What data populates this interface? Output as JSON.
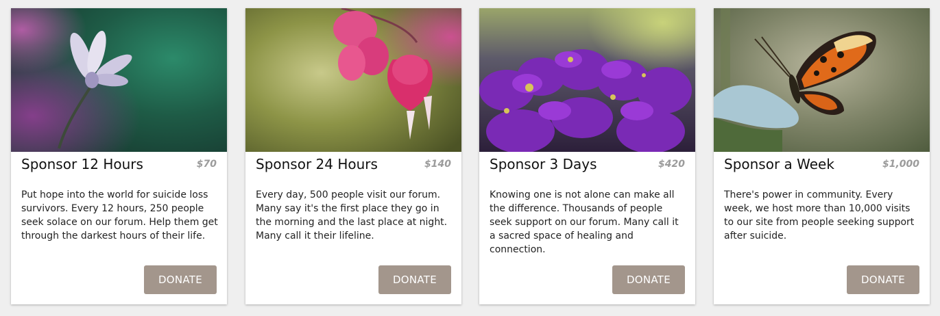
{
  "cards": [
    {
      "title": "Sponsor 12 Hours",
      "price": "$70",
      "description": "Put hope into the world for suicide loss survivors. Every 12 hours, 250 people seek solace on our forum. Help them get through the darkest hours of their life.",
      "button_label": "DONATE",
      "image": "white-cosmos-flower-photo"
    },
    {
      "title": "Sponsor 24 Hours",
      "price": "$140",
      "description": "Every day, 500 people visit our forum. Many say it's the first place they go in the morning and the last place at night. Many call it their lifeline.",
      "button_label": "DONATE",
      "image": "bleeding-heart-flower-photo"
    },
    {
      "title": "Sponsor 3 Days",
      "price": "$420",
      "description": "Knowing one is not alone can make all the difference. Thousands of people seek support on our forum. Many call it a sacred space of healing and connection.",
      "button_label": "DONATE",
      "image": "purple-daisies-photo"
    },
    {
      "title": "Sponsor a Week",
      "price": "$1,000",
      "description": "There's power in community. Every week, we host more than 10,000 visits to our site from people seeking support after suicide.",
      "button_label": "DONATE",
      "image": "orange-butterfly-photo"
    }
  ],
  "colors": {
    "button_bg": "#a3968c",
    "price_text": "#9b9b9b",
    "page_bg": "#efefef"
  }
}
